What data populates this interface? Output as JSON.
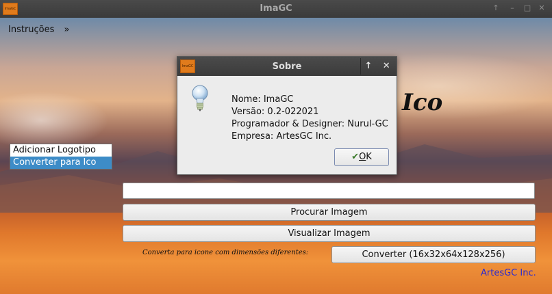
{
  "window": {
    "title": "ImaGC",
    "icon_text": "ImaGC"
  },
  "menu": {
    "items": [
      "Instruções",
      "»"
    ]
  },
  "list": {
    "items": [
      "Adicionar Logotipo",
      "Converter para Ico"
    ]
  },
  "panel": {
    "heading": "Ico",
    "path_field": {
      "value": "",
      "placeholder": ""
    },
    "browse_label": "Procurar Imagem",
    "view_label": "Visualizar Imagem",
    "hint": "Converta para icone com dimensões diferentes:",
    "convert_label": "Converter (16x32x64x128x256)",
    "company": "ArtesGC Inc."
  },
  "dialog": {
    "title": "Sobre",
    "icon_text": "ImaGC",
    "lines": [
      "Nome: ImaGC",
      "Versão: 0.2-022021",
      "Programador & Designer: Nurul-GC",
      "Empresa: ArtesGC Inc."
    ],
    "ok_label": "OK",
    "ok_mnemonic": "O",
    "ok_rest": "K",
    "ctrl_up": "↑",
    "ctrl_close": "✕"
  },
  "colors": {
    "selection": "#3d8cc7",
    "company_link": "#2a2ad0"
  }
}
